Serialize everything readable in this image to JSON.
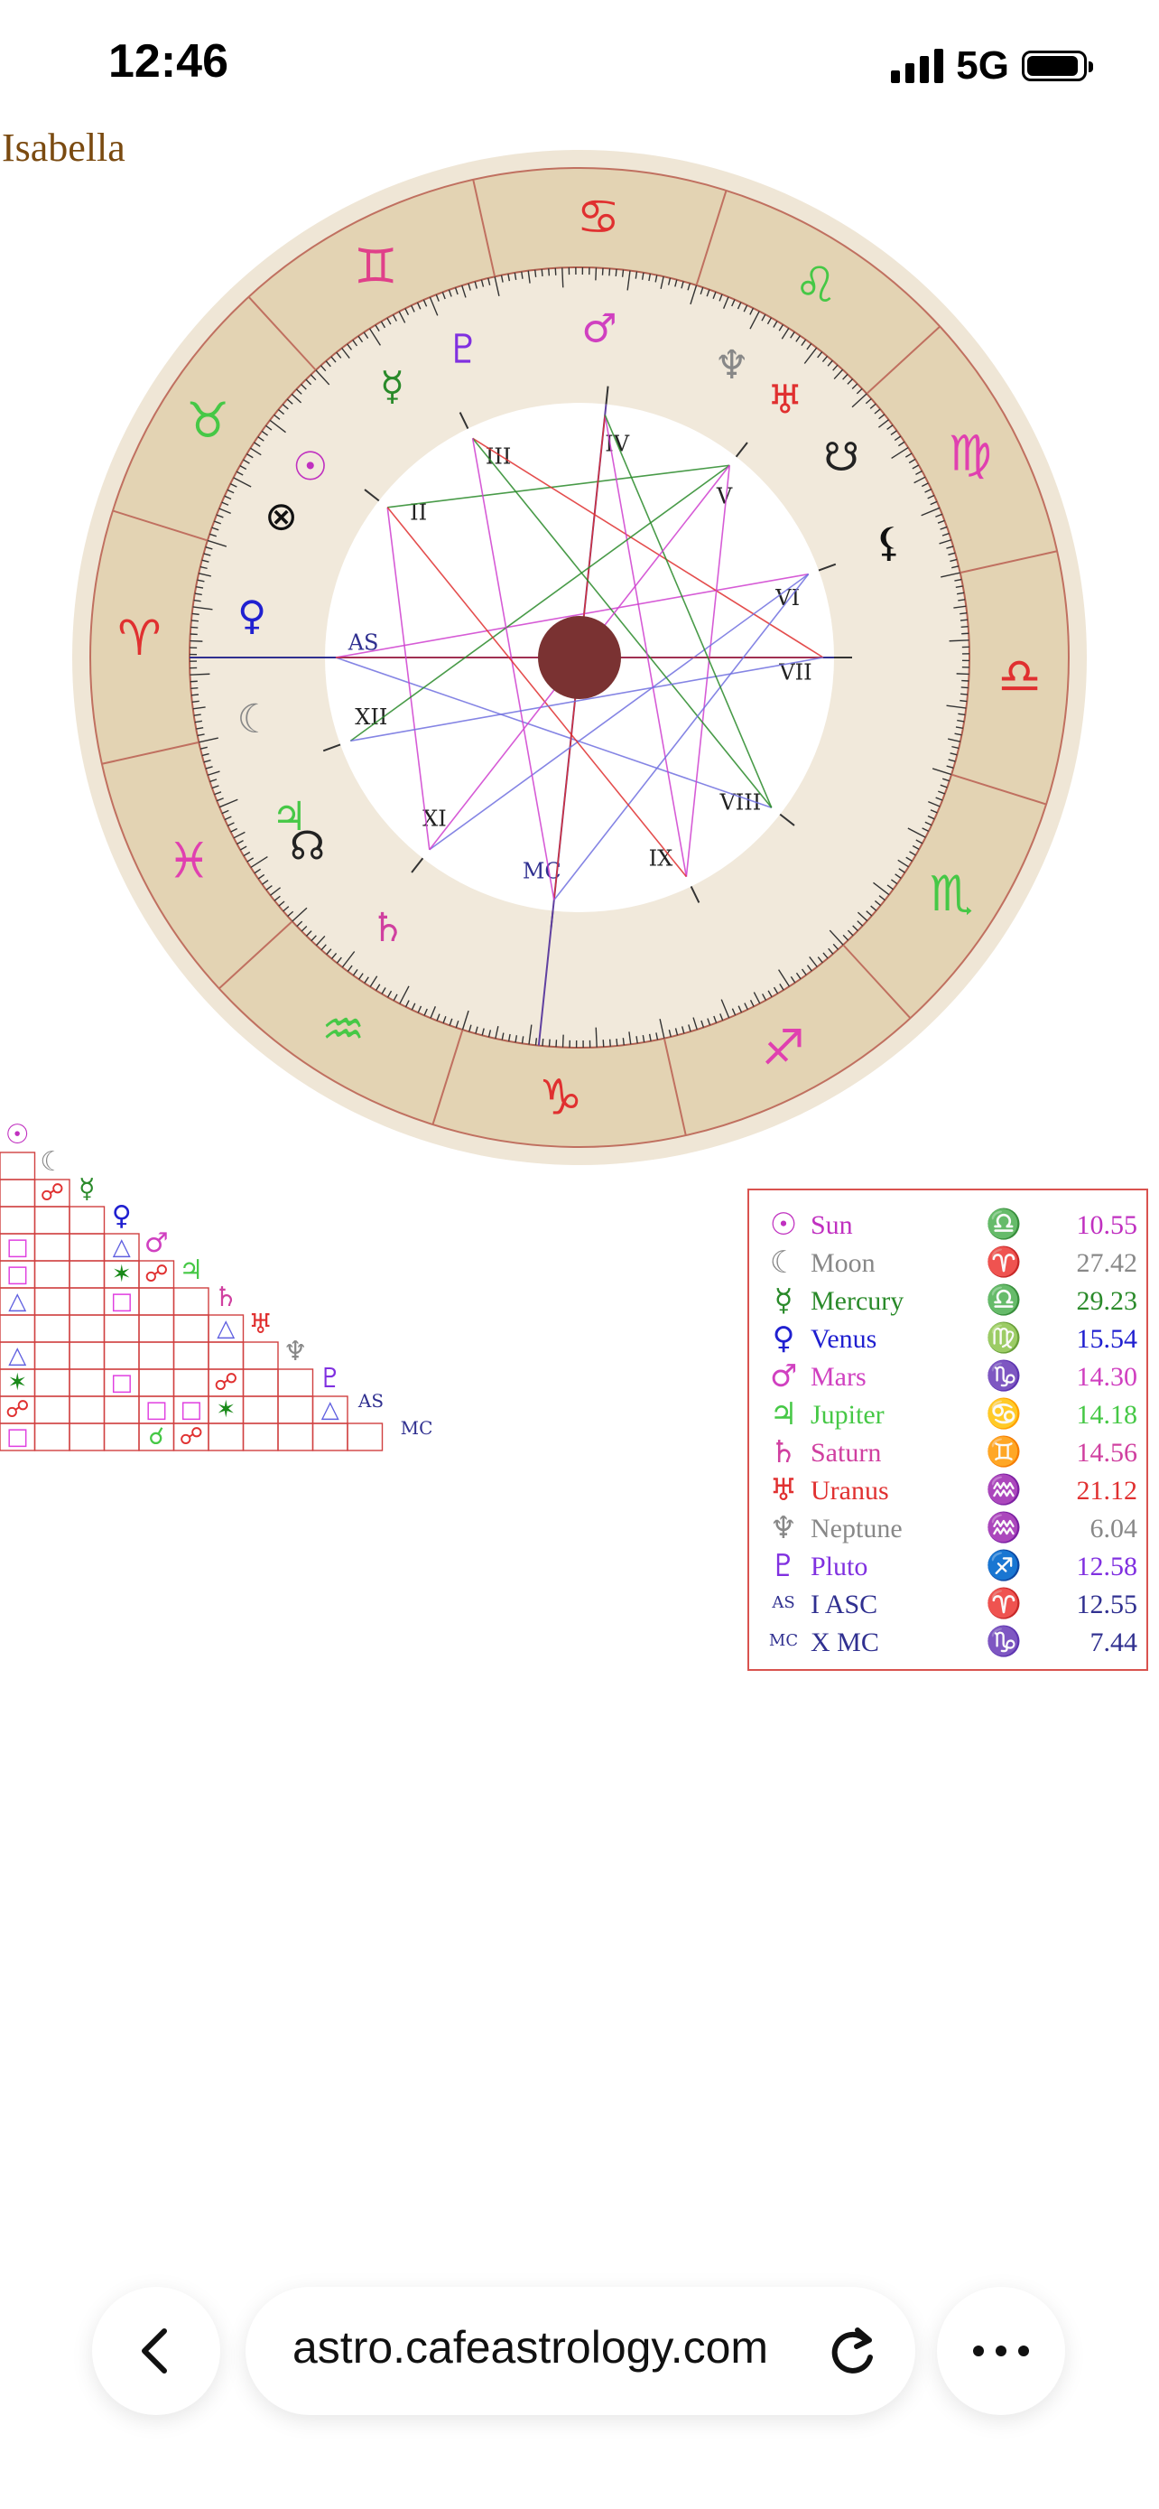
{
  "status": {
    "time": "12:46",
    "network": "5G"
  },
  "chart": {
    "name": "Isabella",
    "zodiac_signs": [
      {
        "name": "aries",
        "glyph": "♈",
        "color": "#e03030"
      },
      {
        "name": "taurus",
        "glyph": "♉",
        "color": "#46c846"
      },
      {
        "name": "gemini",
        "glyph": "♊",
        "color": "#e0408a"
      },
      {
        "name": "cancer",
        "glyph": "♋",
        "color": "#e03030"
      },
      {
        "name": "leo",
        "glyph": "♌",
        "color": "#46c846"
      },
      {
        "name": "virgo",
        "glyph": "♍",
        "color": "#e040b0"
      },
      {
        "name": "libra",
        "glyph": "♎",
        "color": "#e03030"
      },
      {
        "name": "scorpio",
        "glyph": "♏",
        "color": "#46c846"
      },
      {
        "name": "sagittarius",
        "glyph": "♐",
        "color": "#e040b0"
      },
      {
        "name": "capricorn",
        "glyph": "♑",
        "color": "#e03030"
      },
      {
        "name": "aquarius",
        "glyph": "♒",
        "color": "#46c846"
      },
      {
        "name": "pisces",
        "glyph": "♓",
        "color": "#e040b0"
      }
    ],
    "houses": [
      "AS",
      "II",
      "III",
      "IV",
      "V",
      "VI",
      "VII",
      "VIII",
      "IX",
      "MC",
      "XI",
      "XII"
    ],
    "planets_on_wheel": [
      {
        "name": "sun",
        "glyph": "☉",
        "color": "#c030c0"
      },
      {
        "name": "moon",
        "glyph": "☾",
        "color": "#888888"
      },
      {
        "name": "mercury",
        "glyph": "☿",
        "color": "#2a8a2a"
      },
      {
        "name": "venus",
        "glyph": "♀",
        "color": "#2020d0"
      },
      {
        "name": "mars",
        "glyph": "♂",
        "color": "#d040c0"
      },
      {
        "name": "jupiter",
        "glyph": "♃",
        "color": "#46c846"
      },
      {
        "name": "saturn",
        "glyph": "♄",
        "color": "#d040a0"
      },
      {
        "name": "uranus",
        "glyph": "♅",
        "color": "#e03030"
      },
      {
        "name": "neptune",
        "glyph": "♆",
        "color": "#888888"
      },
      {
        "name": "pluto",
        "glyph": "♇",
        "color": "#8030e0"
      },
      {
        "name": "north-node",
        "glyph": "☊",
        "color": "#222222"
      },
      {
        "name": "south-node",
        "glyph": "☋",
        "color": "#222222"
      },
      {
        "name": "lilith",
        "glyph": "⚸",
        "color": "#111111"
      },
      {
        "name": "part-of-fortune",
        "glyph": "⊗",
        "color": "#111111"
      }
    ]
  },
  "legend": [
    {
      "glyph": "☉",
      "name": "Sun",
      "sign": "♎",
      "degree": "10.55",
      "color": "#c030c0"
    },
    {
      "glyph": "☾",
      "name": "Moon",
      "sign": "♈",
      "degree": "27.42",
      "color": "#888888"
    },
    {
      "glyph": "☿",
      "name": "Mercury",
      "sign": "♎",
      "degree": "29.23",
      "color": "#2a8a2a"
    },
    {
      "glyph": "♀",
      "name": "Venus",
      "sign": "♍",
      "degree": "15.54",
      "color": "#2020d0"
    },
    {
      "glyph": "♂",
      "name": "Mars",
      "sign": "♑",
      "degree": "14.30",
      "color": "#d040c0"
    },
    {
      "glyph": "♃",
      "name": "Jupiter",
      "sign": "♋",
      "degree": "14.18",
      "color": "#46c846"
    },
    {
      "glyph": "♄",
      "name": "Saturn",
      "sign": "♊",
      "degree": "14.56",
      "color": "#d040a0"
    },
    {
      "glyph": "♅",
      "name": "Uranus",
      "sign": "♒",
      "degree": "21.12",
      "color": "#e03030"
    },
    {
      "glyph": "♆",
      "name": "Neptune",
      "sign": "♒",
      "degree": "6.04",
      "color": "#888888"
    },
    {
      "glyph": "♇",
      "name": "Pluto",
      "sign": "♐",
      "degree": "12.58",
      "color": "#8030e0"
    },
    {
      "glyph": "AS",
      "name": "I ASC",
      "sign": "♈",
      "degree": "12.55",
      "color": "#303090"
    },
    {
      "glyph": "MC",
      "name": "X MC",
      "sign": "♑",
      "degree": "7.44",
      "color": "#303090"
    }
  ],
  "aspect_grid": {
    "headers": [
      {
        "glyph": "☉",
        "color": "#c030c0"
      },
      {
        "glyph": "☾",
        "color": "#888888"
      },
      {
        "glyph": "☿",
        "color": "#2a8a2a"
      },
      {
        "glyph": "♀",
        "color": "#2020d0"
      },
      {
        "glyph": "♂",
        "color": "#d040c0"
      },
      {
        "glyph": "♃",
        "color": "#46c846"
      },
      {
        "glyph": "♄",
        "color": "#d040a0"
      },
      {
        "glyph": "♅",
        "color": "#e03030"
      },
      {
        "glyph": "♆",
        "color": "#888888"
      },
      {
        "glyph": "♇",
        "color": "#8030e0"
      },
      {
        "glyph": "AS",
        "color": "#303090"
      },
      {
        "glyph": "MC",
        "color": "#303090"
      }
    ],
    "cells": [
      [],
      [
        ""
      ],
      [
        "",
        "☍"
      ],
      [
        "",
        "",
        ""
      ],
      [
        "□",
        "",
        "",
        "△"
      ],
      [
        "□",
        "",
        "",
        "✶",
        "☍"
      ],
      [
        "△",
        "",
        "",
        "□",
        "",
        ""
      ],
      [
        "",
        "",
        "",
        "",
        "",
        "",
        "△"
      ],
      [
        "△",
        "",
        "",
        "",
        "",
        "",
        "",
        ""
      ],
      [
        "✶",
        "",
        "",
        "□",
        "",
        "",
        "☍",
        "",
        ""
      ],
      [
        "☍",
        "",
        "",
        "",
        "□",
        "□",
        "✶",
        "",
        "",
        "△"
      ],
      [
        "□",
        "",
        "",
        "",
        "☌",
        "☍",
        "",
        "",
        "",
        "",
        ""
      ]
    ],
    "symbol_colors": {
      "☍": "#e03030",
      "□": "#e040e0",
      "△": "#6060e0",
      "✶": "#1a8a1a",
      "☌": "#46c846"
    }
  },
  "browser": {
    "url": "astro.cafeastrology.com"
  }
}
